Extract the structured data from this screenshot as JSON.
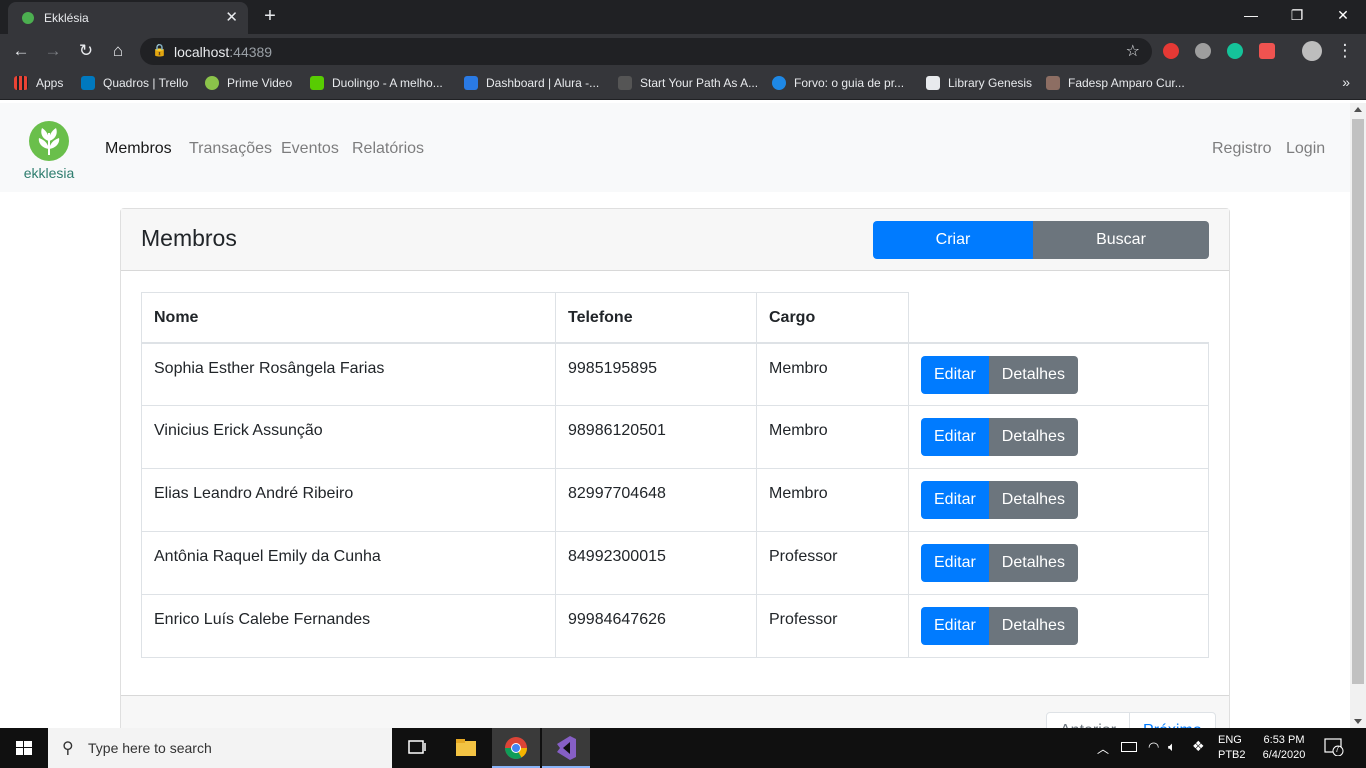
{
  "browser": {
    "tab_title": "Ekklésia",
    "url_host": "localhost",
    "url_port": ":44389",
    "bookmarks": [
      {
        "label": "Apps",
        "color": "#ea4335"
      },
      {
        "label": "Quadros | Trello",
        "color": "#0079bf"
      },
      {
        "label": "Prime Video",
        "color": "#8bc34a"
      },
      {
        "label": "Duolingo - A melho...",
        "color": "#58cc02"
      },
      {
        "label": "Dashboard | Alura -...",
        "color": "#2a7ae4"
      },
      {
        "label": "Start Your Path As A...",
        "color": "#333333"
      },
      {
        "label": "Forvo: o guia de pr...",
        "color": "#1e88e5"
      },
      {
        "label": "Library Genesis",
        "color": "#ffffff"
      },
      {
        "label": "Fadesp Amparo Cur...",
        "color": "#8d6e63"
      }
    ]
  },
  "app": {
    "brand": "ekklesia",
    "nav": {
      "membros": "Membros",
      "transacoes": "Transações",
      "eventos": "Eventos",
      "relatorios": "Relatórios",
      "registro": "Registro",
      "login": "Login"
    },
    "card": {
      "title": "Membros",
      "criar": "Criar",
      "buscar": "Buscar"
    },
    "table": {
      "headers": [
        "Nome",
        "Telefone",
        "Cargo"
      ],
      "edit_label": "Editar",
      "details_label": "Detalhes",
      "rows": [
        {
          "nome": "Sophia Esther Rosângela Farias",
          "telefone": "9985195895",
          "cargo": "Membro"
        },
        {
          "nome": "Vinicius Erick Assunção",
          "telefone": "98986120501",
          "cargo": "Membro"
        },
        {
          "nome": "Elias Leandro André Ribeiro",
          "telefone": "82997704648",
          "cargo": "Membro"
        },
        {
          "nome": "Antônia Raquel Emily da Cunha",
          "telefone": "84992300015",
          "cargo": "Professor"
        },
        {
          "nome": "Enrico Luís Calebe Fernandes",
          "telefone": "99984647626",
          "cargo": "Professor"
        }
      ]
    },
    "pager": {
      "prev": "Anterior",
      "next": "Próximo"
    }
  },
  "taskbar": {
    "search_placeholder": "Type here to search",
    "lang": "ENG",
    "layout": "PTB2",
    "time": "6:53 PM",
    "date": "6/4/2020",
    "notifications": "7"
  }
}
